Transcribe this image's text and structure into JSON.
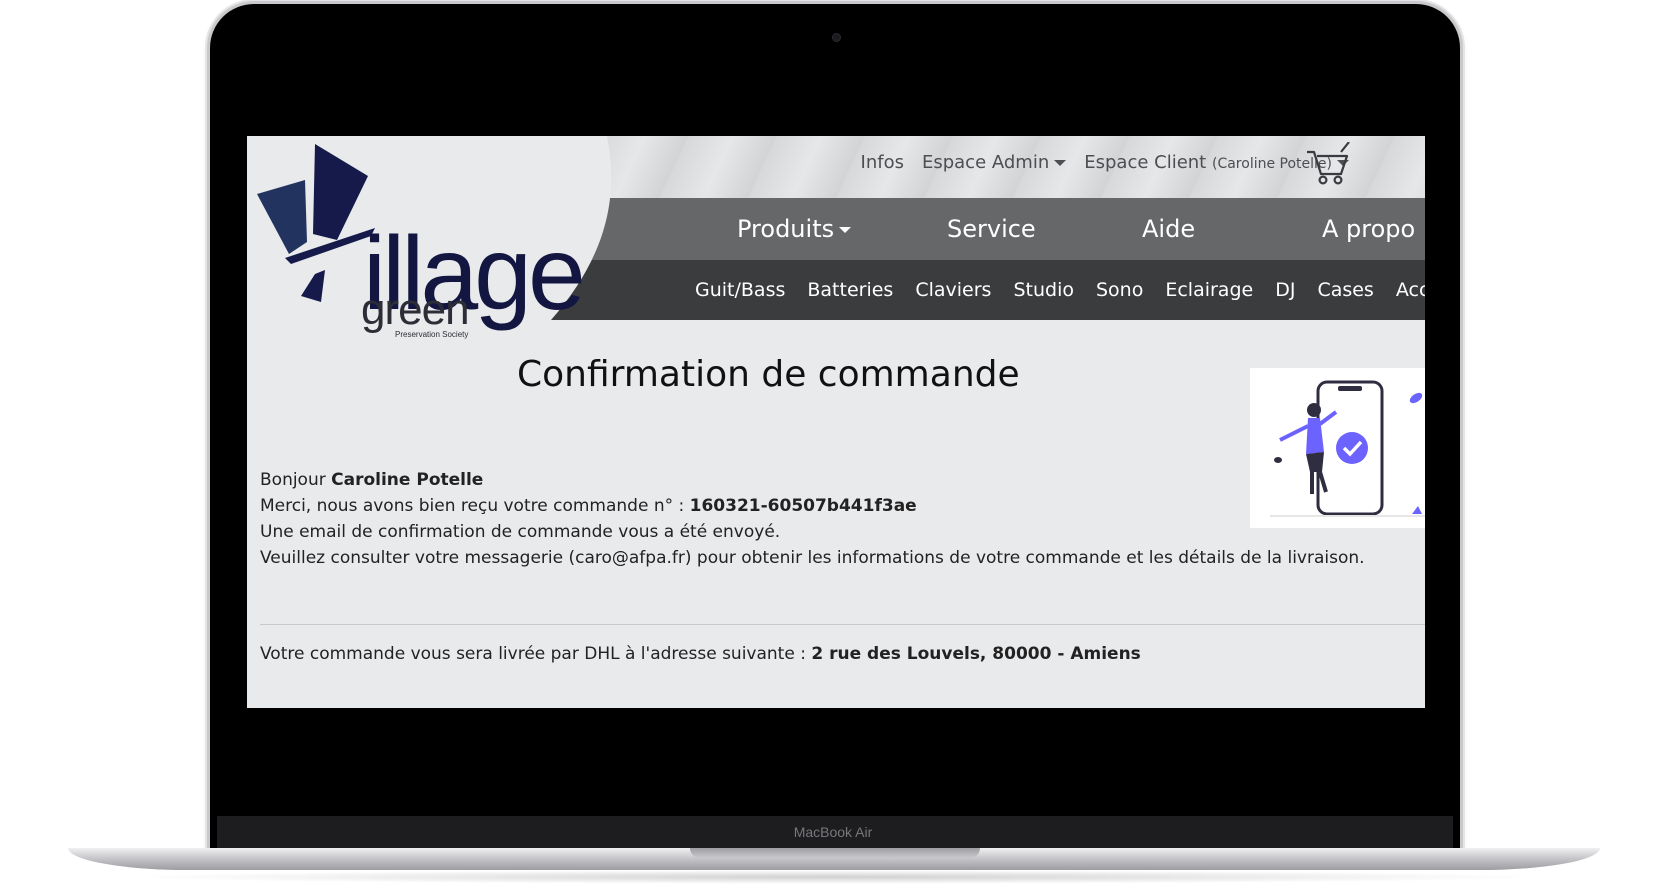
{
  "device": {
    "model_label": "MacBook Air"
  },
  "logo": {
    "word": "illage",
    "sub_word": "green",
    "tagline": "Preservation Society"
  },
  "top_nav": {
    "infos": "Infos",
    "admin": "Espace Admin",
    "client": "Espace Client",
    "client_user": "(Caroline Potelle)"
  },
  "main_nav": {
    "produits": "Produits",
    "service": "Service",
    "aide": "Aide",
    "apropos": "A propo"
  },
  "sub_nav": [
    "Guit/Bass",
    "Batteries",
    "Claviers",
    "Studio",
    "Sono",
    "Eclairage",
    "DJ",
    "Cases",
    "Access"
  ],
  "page": {
    "title": "Confirmation de commande",
    "greeting": "Bonjour",
    "customer_name": "Caroline Potelle",
    "order_prefix": "Merci, nous avons bien reçu votre commande n° :",
    "order_number": "160321-60507b441f3ae",
    "email_sent": "Une email de confirmation de commande vous a été envoyé.",
    "consult_msg": "Veuillez consulter votre messagerie (caro@afpa.fr) pour obtenir les informations de votre commande et les détails de la livraison.",
    "delivery_prefix": "Votre commande vous sera livrée par DHL à l'adresse suivante :",
    "delivery_address": "2 rue des Louvels, 80000 - Amiens"
  },
  "colors": {
    "nav_main": "#666769",
    "nav_sub": "#3b3c3e",
    "page_bg": "#e9eaec",
    "logo_navy": "#131640",
    "accent_purple": "#6c63ff"
  }
}
